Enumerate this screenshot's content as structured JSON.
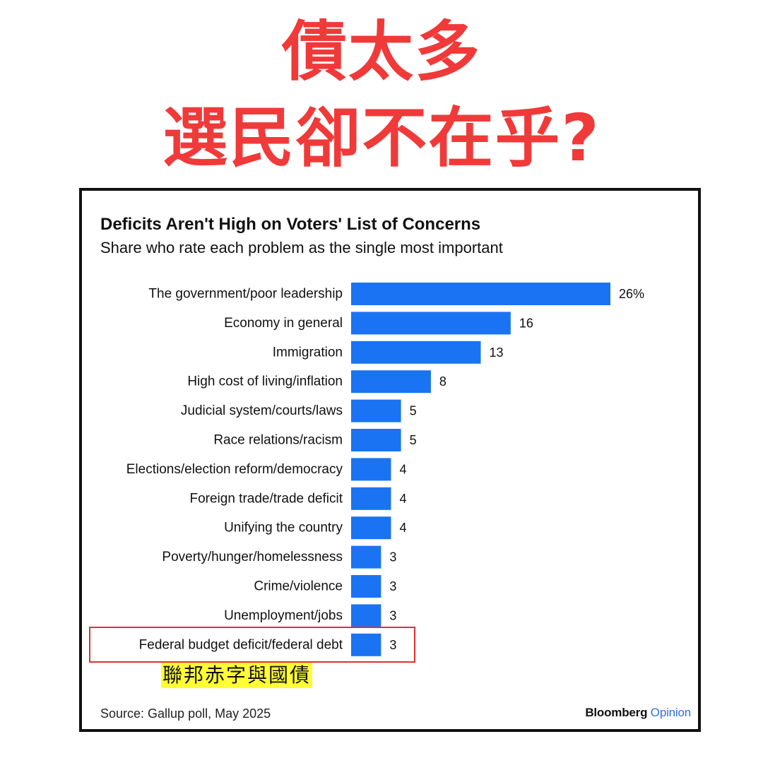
{
  "headline": {
    "line1": "債太多",
    "line2": "選民卻不在乎?"
  },
  "annotation": "聯邦赤字與國債",
  "highlighted_category": "Federal budget deficit/federal debt",
  "source": "Source: Gallup poll, May 2025",
  "brand": {
    "name": "Bloomberg",
    "suffix": "Opinion"
  },
  "colors": {
    "headline": "#f03a3a",
    "bar": "#1a73f2",
    "brand_accent": "#2e6fe8",
    "highlight": "#ffff33",
    "box": "#e23030"
  },
  "chart_data": {
    "type": "bar",
    "orientation": "horizontal",
    "title": "Deficits Aren't High on Voters' List of Concerns",
    "subtitle": "Share who rate each problem as the single most important",
    "categories": [
      "The government/poor leadership",
      "Economy in general",
      "Immigration",
      "High cost of living/inflation",
      "Judicial system/courts/laws",
      "Race relations/racism",
      "Elections/election reform/democracy",
      "Foreign trade/trade deficit",
      "Unifying the country",
      "Poverty/hunger/homelessness",
      "Crime/violence",
      "Unemployment/jobs",
      "Federal budget deficit/federal debt"
    ],
    "values": [
      26,
      16,
      13,
      8,
      5,
      5,
      4,
      4,
      4,
      3,
      3,
      3,
      3
    ],
    "value_labels": [
      "26%",
      "16",
      "13",
      "8",
      "5",
      "5",
      "4",
      "4",
      "4",
      "3",
      "3",
      "3",
      "3"
    ],
    "xlim": [
      0,
      26
    ],
    "grid": false,
    "legend": false
  }
}
